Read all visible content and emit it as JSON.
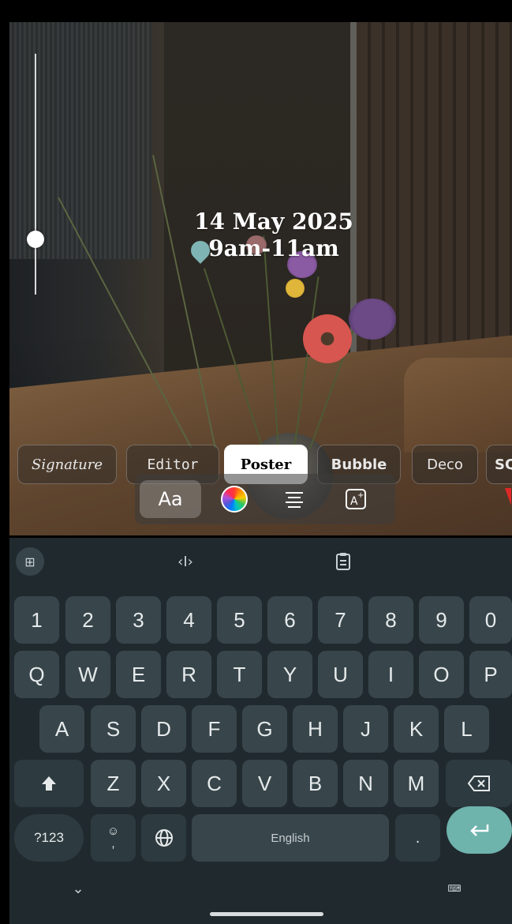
{
  "overlay": {
    "date_line": "14 May 2025",
    "time_line": "9am-11am"
  },
  "styles": {
    "chips": [
      "Signature",
      "Editor",
      "Poster",
      "Bubble",
      "Deco",
      "SQ"
    ],
    "active": "Poster"
  },
  "text_tools": {
    "font_label": "Aa",
    "color_icon": "color-wheel-icon",
    "align_icon": "align-center-icon",
    "effects_icon": "text-effects-icon"
  },
  "keyboard": {
    "toolbar": {
      "apps_icon": "grid-icon",
      "cursor_icon": "text-cursor-icon",
      "clipboard_icon": "clipboard-icon"
    },
    "row_numbers": [
      "1",
      "2",
      "3",
      "4",
      "5",
      "6",
      "7",
      "8",
      "9",
      "0"
    ],
    "row_q": [
      "Q",
      "W",
      "E",
      "R",
      "T",
      "Y",
      "U",
      "I",
      "O",
      "P"
    ],
    "row_a": [
      "A",
      "S",
      "D",
      "F",
      "G",
      "H",
      "J",
      "K",
      "L"
    ],
    "row_z": [
      "Z",
      "X",
      "C",
      "V",
      "B",
      "N",
      "M"
    ],
    "symbols_label": "?123",
    "emoji_comma_label": "☺\n,",
    "space_label": "English",
    "period_label": ".",
    "shift_icon": "shift-icon",
    "backspace_icon": "backspace-icon",
    "globe_icon": "globe-icon",
    "enter_icon": "enter-icon"
  },
  "colors": {
    "keyboard_bg": "#202a2e",
    "key_bg": "#38464b",
    "enter_key": "#6fb3ad",
    "active_chip": "#ffffff"
  }
}
